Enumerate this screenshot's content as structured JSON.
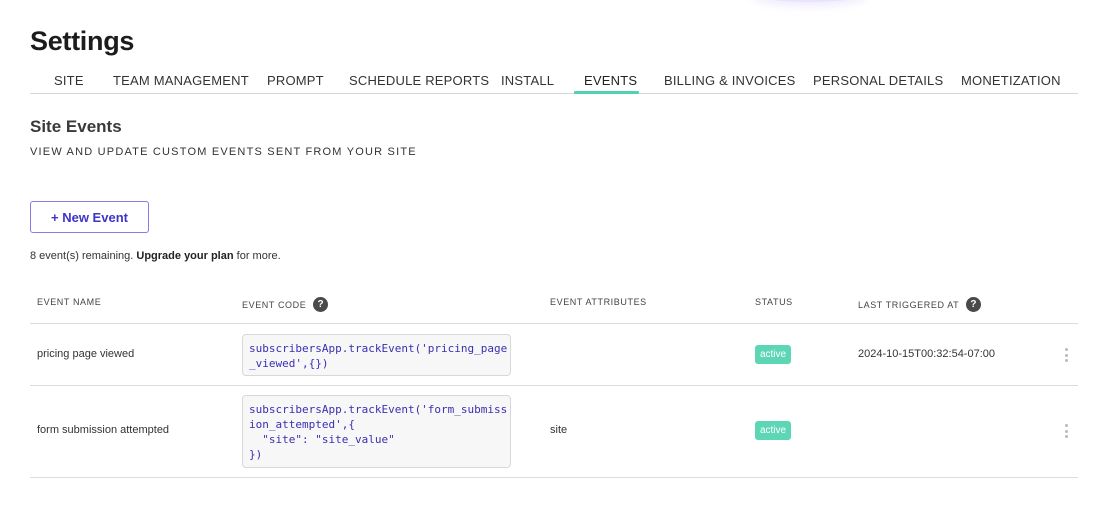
{
  "page": {
    "title": "Settings"
  },
  "tabs": [
    {
      "label": "SITE"
    },
    {
      "label": "TEAM MANAGEMENT"
    },
    {
      "label": "PROMPT"
    },
    {
      "label": "SCHEDULE REPORTS"
    },
    {
      "label": "INSTALL"
    },
    {
      "label": "EVENTS",
      "active": true
    },
    {
      "label": "BILLING & INVOICES"
    },
    {
      "label": "PERSONAL DETAILS"
    },
    {
      "label": "MONETIZATION"
    }
  ],
  "section": {
    "title": "Site Events",
    "subtitle": "VIEW AND UPDATE CUSTOM EVENTS SENT FROM YOUR SITE"
  },
  "new_event_button": {
    "label": "+ New Event"
  },
  "remaining": {
    "prefix": "8 event(s) remaining.",
    "link": "Upgrade your plan",
    "suffix": "for more."
  },
  "table": {
    "columns": {
      "event_name": "EVENT NAME",
      "event_code": "EVENT CODE",
      "event_attributes": "EVENT ATTRIBUTES",
      "status": "STATUS",
      "last_triggered": "LAST TRIGGERED AT"
    },
    "help_icon_glyph": "?",
    "rows": [
      {
        "name": "pricing page viewed",
        "code": "subscribersApp.trackEvent('pricing_page\n_viewed',{})",
        "attributes": "",
        "status": "active",
        "last_triggered": "2024-10-15T00:32:54-07:00"
      },
      {
        "name": "form submission attempted",
        "code": "subscribersApp.trackEvent('form_submiss\nion_attempted',{\n  \"site\": \"site_value\"\n})",
        "attributes": "site",
        "status": "active",
        "last_triggered": ""
      }
    ]
  },
  "colors": {
    "accent_tab_underline": "#4fd1b3",
    "button_border": "#8a7be6",
    "button_text": "#3d35c9",
    "code_text": "#3a2fb0",
    "status_badge": "#5dd6b6"
  }
}
